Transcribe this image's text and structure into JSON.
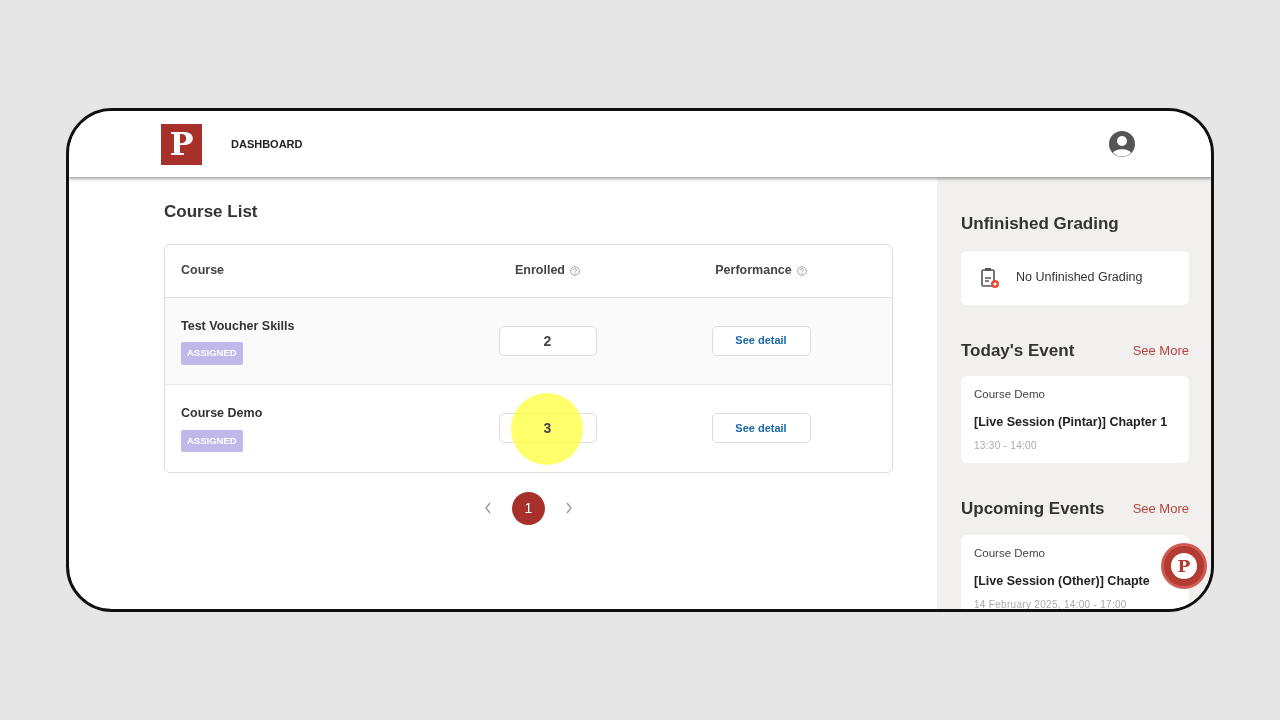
{
  "header": {
    "logo": "P",
    "nav": "DASHBOARD"
  },
  "course_list": {
    "title": "Course List",
    "columns": [
      "Course",
      "Enrolled",
      "Performance"
    ],
    "rows": [
      {
        "course": "Test Voucher Skills",
        "tag": "ASSIGNED",
        "enrolled": "2",
        "action": "See detail",
        "highlighted": false
      },
      {
        "course": "Course Demo",
        "tag": "ASSIGNED",
        "enrolled": "3",
        "action": "See detail",
        "highlighted": true
      }
    ],
    "pagination": [
      {
        "label": "1",
        "selected": true
      }
    ]
  },
  "sidebar": {
    "grading": {
      "title": "Unfinished Grading",
      "empty": "No Unfinished Grading"
    },
    "sections": [
      {
        "title": "Today's Event",
        "link": "See More",
        "events": [
          {
            "course": "Course Demo",
            "title": "[Live Session (Pintar)] Chapter 1",
            "time": "13:30 - 14:00"
          }
        ]
      },
      {
        "title": "Upcoming Events",
        "link": "See More",
        "events": [
          {
            "course": "Course Demo",
            "title": "[Live Session (Other)] Chapte",
            "time": "14 February 2025, 14:00 - 17:00"
          }
        ]
      }
    ]
  },
  "chat_button": {
    "label": "P"
  }
}
